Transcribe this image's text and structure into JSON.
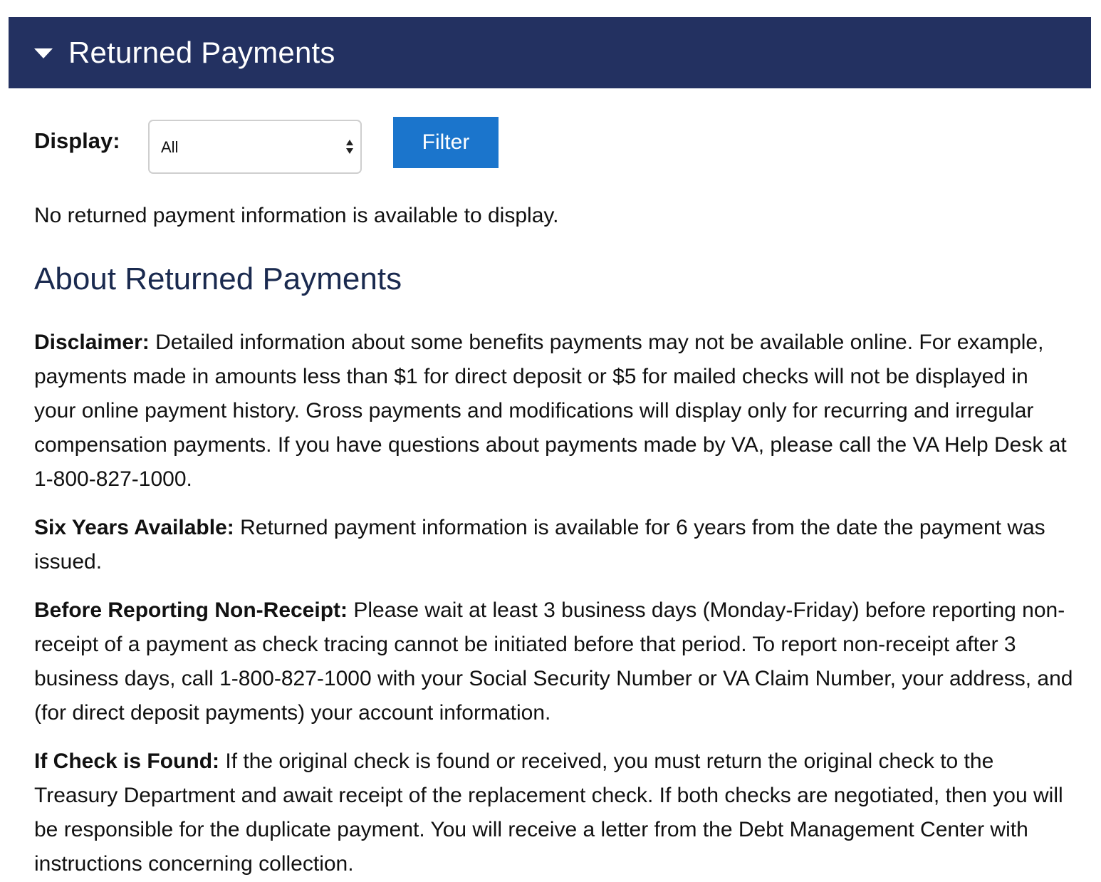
{
  "accordion": {
    "title": "Returned Payments",
    "toggle_icon": "caret-down-icon"
  },
  "filter": {
    "label": "Display:",
    "selected": "All",
    "button_label": "Filter"
  },
  "empty_message": "No returned payment information is available to display.",
  "about": {
    "heading": "About Returned Payments",
    "sections": [
      {
        "title": "Disclaimer:",
        "text": "Detailed information about some benefits payments may not be available online. For example, payments made in amounts less than $1 for direct deposit or $5 for mailed checks will not be displayed in your online payment history. Gross payments and modifications will display only for recurring and irregular compensation payments. If you have questions about payments made by VA, please call the VA Help Desk at 1-800-827-1000."
      },
      {
        "title": "Six Years Available:",
        "text": "Returned payment information is available for 6 years from the date the payment was issued."
      },
      {
        "title": "Before Reporting Non-Receipt:",
        "text": "Please wait at least 3 business days (Monday-Friday) before reporting non-receipt of a payment as check tracing cannot be initiated before that period. To report non-receipt after 3 business days, call 1-800-827-1000 with your Social Security Number or VA Claim Number, your address, and (for direct deposit payments) your account information."
      },
      {
        "title": "If Check is Found:",
        "text": "If the original check is found or received, you must return the original check to the Treasury Department and await receipt of the replacement check. If both checks are negotiated, then you will be responsible for the duplicate payment. You will receive a letter from the Debt Management Center with instructions concerning collection."
      }
    ]
  },
  "colors": {
    "header_bg": "#233161",
    "button_bg": "#1b75cc",
    "heading_text": "#1a2a4f"
  }
}
